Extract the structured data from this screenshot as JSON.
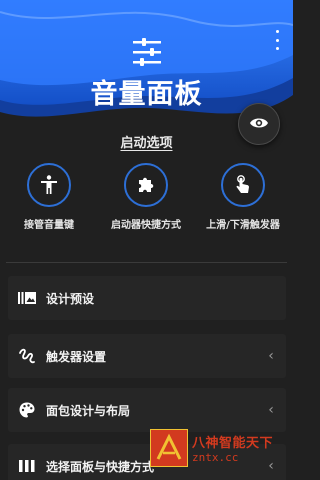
{
  "header": {
    "app_title": "音量面板",
    "app_icon": "sliders-icon",
    "menu_icon": "overflow-menu-icon",
    "accent": "#1f63d8"
  },
  "eye_button": {
    "icon": "eye-icon"
  },
  "section": {
    "title": "启动选项"
  },
  "options": [
    {
      "label": "接管音量键",
      "icon": "accessibility-icon"
    },
    {
      "label": "启动器快捷方式",
      "icon": "puzzle-icon"
    },
    {
      "label": "上滑/下滑触发器",
      "icon": "touch-icon"
    }
  ],
  "menu": [
    {
      "label": "设计预设",
      "icon": "preset-icon",
      "chevron": ""
    },
    {
      "label": "触发器设置",
      "icon": "gesture-icon",
      "chevron": "‹"
    },
    {
      "label": "面包设计与布局",
      "icon": "palette-icon",
      "chevron": "‹"
    },
    {
      "label": "选择面板与快捷方式",
      "icon": "panels-icon",
      "chevron": "‹"
    }
  ],
  "watermark": {
    "line1": "八神智能天下",
    "line2": "zntx.cc",
    "color": "#d23a1f"
  }
}
